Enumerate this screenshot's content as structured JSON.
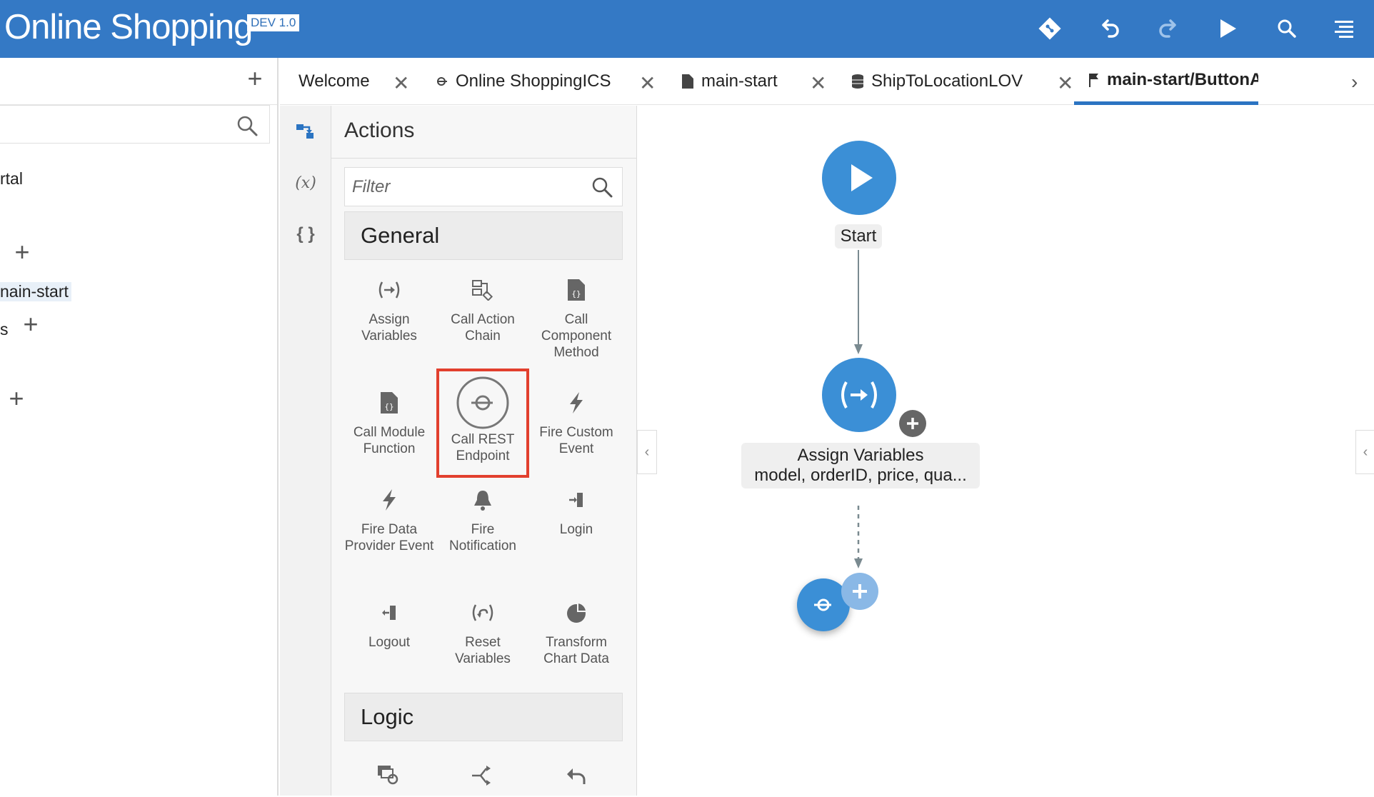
{
  "app": {
    "title": "Online Shopping",
    "env_badge": "DEV 1.0"
  },
  "toolbar": {
    "icons": [
      "git-icon",
      "undo-icon",
      "redo-icon",
      "run-icon",
      "search-icon",
      "menu-icon"
    ]
  },
  "left_panel": {
    "tree_items": [
      {
        "label": "rtal"
      },
      {
        "label": "nain-start"
      },
      {
        "label": "s"
      }
    ]
  },
  "tabs": [
    {
      "label": "Welcome"
    },
    {
      "label": "Online ShoppingICS"
    },
    {
      "label": "main-start"
    },
    {
      "label": "ShipToLocationLOV"
    },
    {
      "label": "main-start/ButtonActionC"
    }
  ],
  "actions_panel": {
    "title": "Actions",
    "filter_placeholder": "Filter",
    "sections": [
      {
        "label": "General"
      },
      {
        "label": "Logic"
      }
    ],
    "items": [
      {
        "label": "Assign Variables"
      },
      {
        "label": "Call Action Chain"
      },
      {
        "label": "Call Component Method"
      },
      {
        "label": "Call Module Function"
      },
      {
        "label": "Call REST Endpoint"
      },
      {
        "label": "Fire Custom Event"
      },
      {
        "label": "Fire Data Provider Event"
      },
      {
        "label": "Fire Notification"
      },
      {
        "label": "Login"
      },
      {
        "label": "Logout"
      },
      {
        "label": "Reset Variables"
      },
      {
        "label": "Transform Chart Data"
      }
    ]
  },
  "canvas": {
    "start_label": "Start",
    "assign_title": "Assign Variables",
    "assign_detail": "model, orderID, price, qua..."
  },
  "colors": {
    "topbar": "#3479c5",
    "node": "#3b8fd6",
    "highlight": "#e2402e",
    "active_tab": "#2b74c2"
  }
}
